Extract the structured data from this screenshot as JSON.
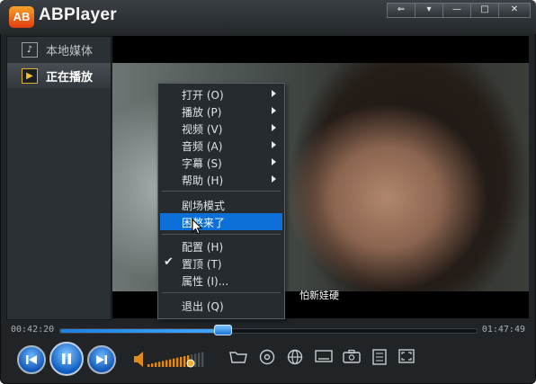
{
  "app": {
    "logo_text": "AB",
    "title": "ABPlayer"
  },
  "window_buttons": [
    {
      "icon": "restore-mini-icon",
      "glyph": "⇐"
    },
    {
      "icon": "menu-dropdown-icon",
      "glyph": "▾"
    },
    {
      "icon": "minimize-icon",
      "glyph": "—"
    },
    {
      "icon": "maximize-icon",
      "glyph": "□"
    },
    {
      "icon": "close-icon",
      "glyph": "✕"
    }
  ],
  "sidebar": {
    "items": [
      {
        "label": "本地媒体",
        "icon": "music-note-icon",
        "glyph": "♪",
        "active": false
      },
      {
        "label": "正在播放",
        "icon": "play-icon",
        "glyph": "▶",
        "active": true
      }
    ]
  },
  "video": {
    "subtitle": "怕新娃硬"
  },
  "context_menu": {
    "items": [
      {
        "label": "打开 (O)",
        "submenu": true
      },
      {
        "label": "播放 (P)",
        "submenu": true
      },
      {
        "label": "视频 (V)",
        "submenu": true
      },
      {
        "label": "音频 (A)",
        "submenu": true
      },
      {
        "label": "字幕 (S)",
        "submenu": true
      },
      {
        "label": "帮助 (H)",
        "submenu": true
      },
      {
        "label": "剧场模式",
        "submenu": false
      },
      {
        "label": "困憋来了",
        "submenu": false,
        "highlighted": true
      },
      {
        "label": "配置 (H)",
        "submenu": false
      },
      {
        "label": "置顶 (T)",
        "submenu": false,
        "checked": true
      },
      {
        "label": "属性 (I)...",
        "submenu": false
      },
      {
        "label": "退出 (Q)",
        "submenu": false
      }
    ]
  },
  "playback": {
    "current_time": "00:42:20",
    "total_time": "01:47:49",
    "progress": 0.393,
    "volume": 0.78
  },
  "controls": {
    "prev_icon": "previous-icon",
    "pause_icon": "pause-icon",
    "next_icon": "next-icon",
    "volume_icon": "speaker-icon"
  },
  "toolbar": [
    {
      "icon": "open-folder-icon",
      "glyph": "⌂"
    },
    {
      "icon": "disc-icon",
      "glyph": "◎"
    },
    {
      "icon": "globe-icon",
      "glyph": "◍"
    },
    {
      "icon": "subtitle-icon",
      "glyph": "▭"
    },
    {
      "icon": "screenshot-icon",
      "glyph": "▣"
    },
    {
      "icon": "playlist-icon",
      "glyph": "☰"
    },
    {
      "icon": "fullscreen-icon",
      "glyph": "⛶"
    }
  ],
  "colors": {
    "accent_blue": "#0d6fd8",
    "logo_orange": "#f5a32a",
    "volume_orange": "#e08a1c"
  }
}
